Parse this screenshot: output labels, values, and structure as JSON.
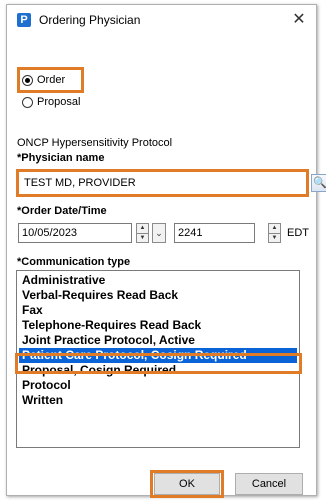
{
  "window": {
    "title": "Ordering Physician",
    "app_icon_letter": "P",
    "close_glyph": "✕"
  },
  "type_radio": {
    "options": [
      "Order",
      "Proposal"
    ],
    "selected": "Order"
  },
  "protocol_text": "ONCP Hypersensitivity Protocol",
  "physician": {
    "label": "*Physician name",
    "value": "TEST MD, PROVIDER"
  },
  "order_datetime": {
    "label": "*Order Date/Time",
    "date": "10/05/2023",
    "time": "2241",
    "timezone": "EDT"
  },
  "communication": {
    "label": "*Communication type",
    "items": [
      "Administrative",
      "Verbal-Requires Read Back",
      "Fax",
      "Telephone-Requires Read Back",
      "Joint Practice Protocol, Active",
      "Patient Care Protocol, Cosign Required",
      "Proposal, Cosign Required",
      "Protocol",
      "Written"
    ],
    "selected_index": 5
  },
  "buttons": {
    "ok": "OK",
    "cancel": "Cancel"
  },
  "colors": {
    "highlight_border": "#e07b28",
    "selection": "#0a64d8"
  }
}
